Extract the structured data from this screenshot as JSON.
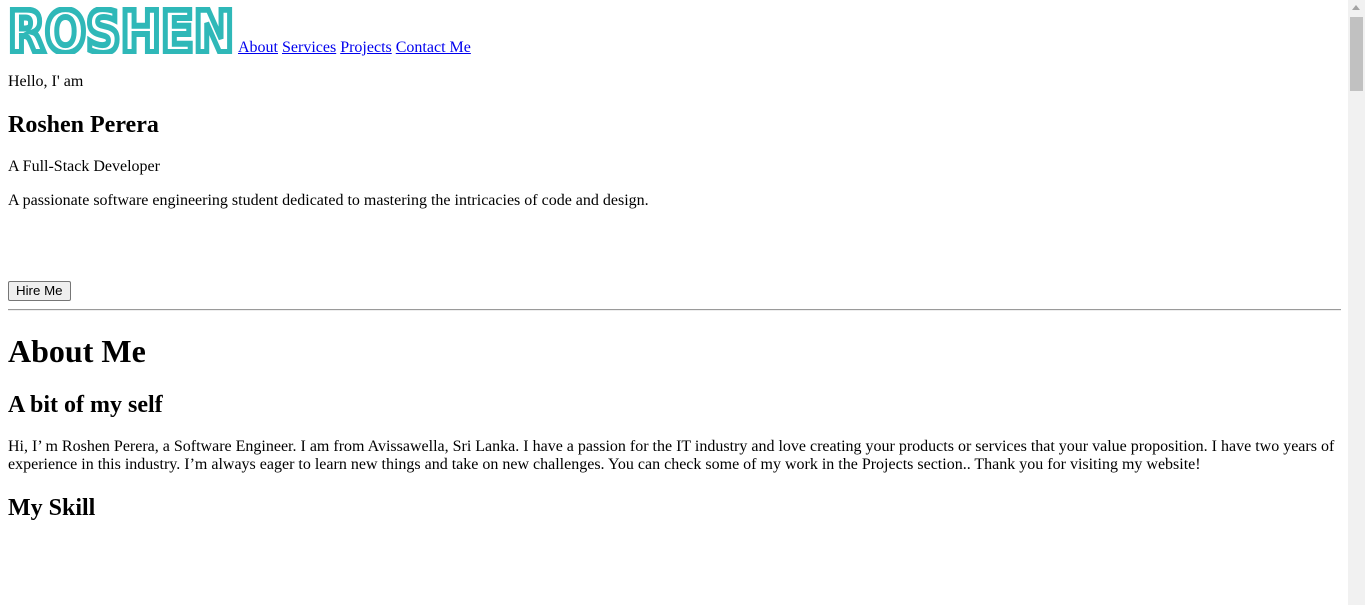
{
  "brand": {
    "logo_text": "ROSHEN",
    "logo_color": "#2fb8b8"
  },
  "nav": {
    "links": [
      {
        "label": "About"
      },
      {
        "label": "Services"
      },
      {
        "label": "Projects"
      },
      {
        "label": "Contact Me"
      }
    ]
  },
  "hero": {
    "greeting": "Hello, I' am",
    "name": "Roshen Perera",
    "role": "A Full-Stack Developer",
    "description": "A passionate software engineering student dedicated to mastering the intricacies of code and design.",
    "hire_button": "Hire Me"
  },
  "about": {
    "title": "About Me",
    "subtitle": "A bit of my self",
    "bio": "Hi, I’ m Roshen Perera, a Software Engineer. I am from Avissawella, Sri Lanka. I have a passion for the IT industry and love creating your products or services that your value proposition. I have two years of experience in this industry. I’m always eager to learn new things and take on new challenges. You can check some of my work in the Projects section.. Thank you for visiting my website!",
    "skills_title": "My Skill"
  }
}
